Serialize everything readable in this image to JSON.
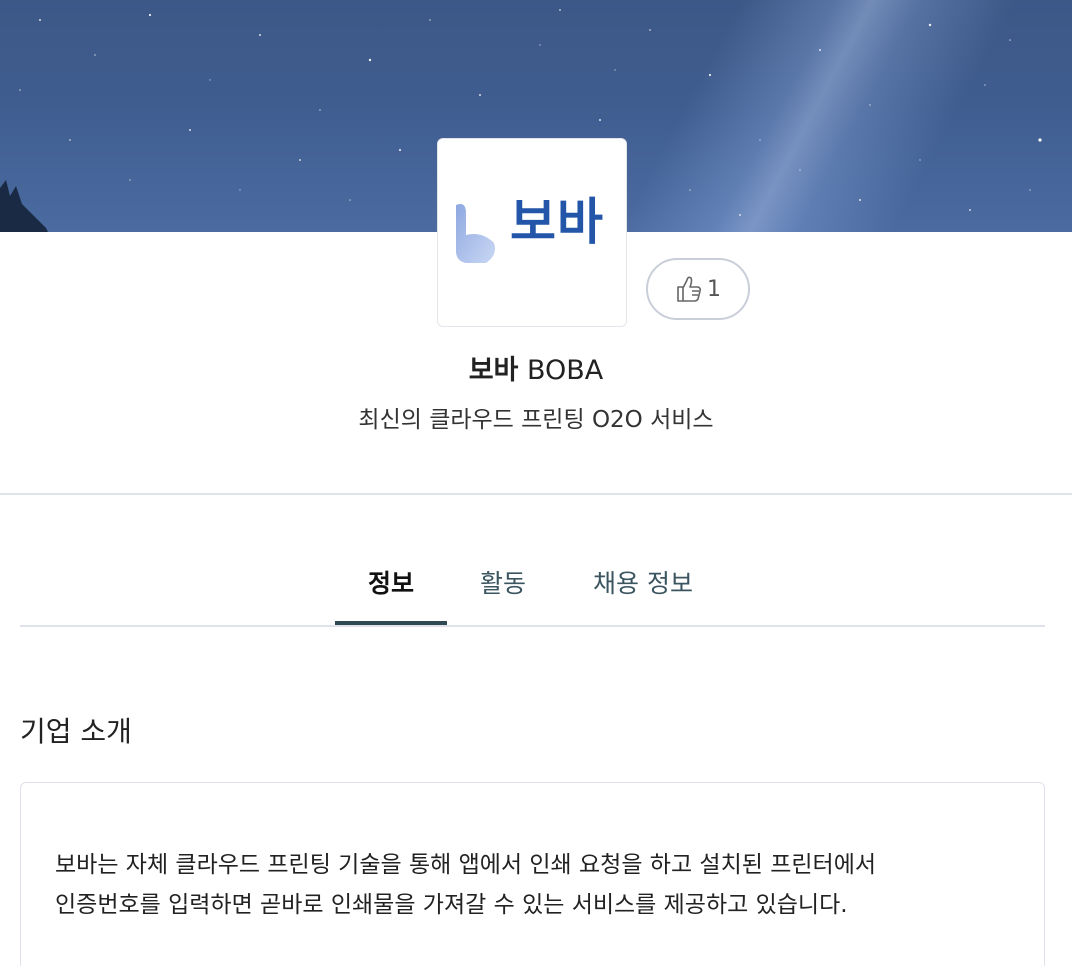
{
  "company": {
    "logo_text": "보바",
    "name_ko": "보바",
    "name_en": "BOBA",
    "tagline": "최신의 클라우드 프린팅 O2O 서비스",
    "likes": "1"
  },
  "tabs": [
    {
      "label": "정보",
      "active": true
    },
    {
      "label": "활동",
      "active": false
    },
    {
      "label": "채용 정보",
      "active": false
    }
  ],
  "intro": {
    "title": "기업 소개",
    "lines": [
      "보바는 자체 클라우드 프린팅 기술을 통해 앱에서 인쇄 요청을 하고 설치된 프린터에서",
      "인증번호를 입력하면 곧바로 인쇄물을 가져갈 수 있는 서비스를 제공하고 있습니다."
    ]
  },
  "icons": {
    "like": "thumbs-up-icon",
    "logo_mark": "boba-logo-icon"
  },
  "colors": {
    "brand_blue": "#2356a8",
    "active_tab": "#2f4a54",
    "cover": "#3f5d8f"
  }
}
